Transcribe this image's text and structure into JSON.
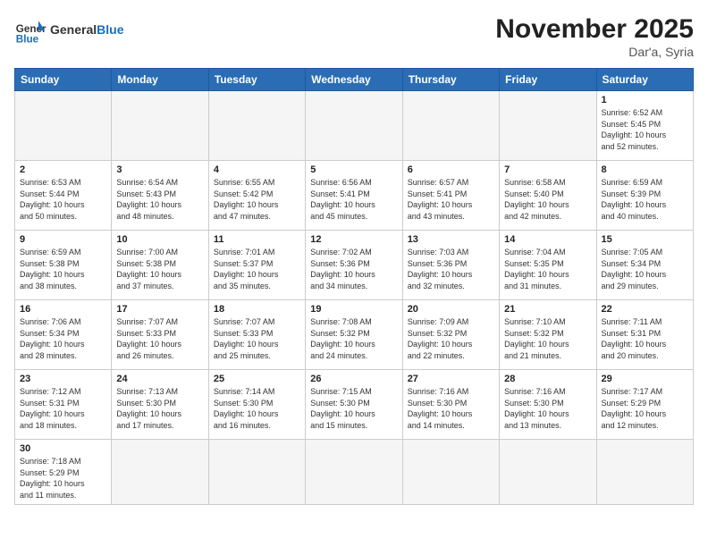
{
  "header": {
    "logo_general": "General",
    "logo_blue": "Blue",
    "month_title": "November 2025",
    "location": "Dar'a, Syria"
  },
  "weekdays": [
    "Sunday",
    "Monday",
    "Tuesday",
    "Wednesday",
    "Thursday",
    "Friday",
    "Saturday"
  ],
  "weeks": [
    [
      {
        "day": "",
        "info": ""
      },
      {
        "day": "",
        "info": ""
      },
      {
        "day": "",
        "info": ""
      },
      {
        "day": "",
        "info": ""
      },
      {
        "day": "",
        "info": ""
      },
      {
        "day": "",
        "info": ""
      },
      {
        "day": "1",
        "info": "Sunrise: 6:52 AM\nSunset: 5:45 PM\nDaylight: 10 hours\nand 52 minutes."
      }
    ],
    [
      {
        "day": "2",
        "info": "Sunrise: 6:53 AM\nSunset: 5:44 PM\nDaylight: 10 hours\nand 50 minutes."
      },
      {
        "day": "3",
        "info": "Sunrise: 6:54 AM\nSunset: 5:43 PM\nDaylight: 10 hours\nand 48 minutes."
      },
      {
        "day": "4",
        "info": "Sunrise: 6:55 AM\nSunset: 5:42 PM\nDaylight: 10 hours\nand 47 minutes."
      },
      {
        "day": "5",
        "info": "Sunrise: 6:56 AM\nSunset: 5:41 PM\nDaylight: 10 hours\nand 45 minutes."
      },
      {
        "day": "6",
        "info": "Sunrise: 6:57 AM\nSunset: 5:41 PM\nDaylight: 10 hours\nand 43 minutes."
      },
      {
        "day": "7",
        "info": "Sunrise: 6:58 AM\nSunset: 5:40 PM\nDaylight: 10 hours\nand 42 minutes."
      },
      {
        "day": "8",
        "info": "Sunrise: 6:59 AM\nSunset: 5:39 PM\nDaylight: 10 hours\nand 40 minutes."
      }
    ],
    [
      {
        "day": "9",
        "info": "Sunrise: 6:59 AM\nSunset: 5:38 PM\nDaylight: 10 hours\nand 38 minutes."
      },
      {
        "day": "10",
        "info": "Sunrise: 7:00 AM\nSunset: 5:38 PM\nDaylight: 10 hours\nand 37 minutes."
      },
      {
        "day": "11",
        "info": "Sunrise: 7:01 AM\nSunset: 5:37 PM\nDaylight: 10 hours\nand 35 minutes."
      },
      {
        "day": "12",
        "info": "Sunrise: 7:02 AM\nSunset: 5:36 PM\nDaylight: 10 hours\nand 34 minutes."
      },
      {
        "day": "13",
        "info": "Sunrise: 7:03 AM\nSunset: 5:36 PM\nDaylight: 10 hours\nand 32 minutes."
      },
      {
        "day": "14",
        "info": "Sunrise: 7:04 AM\nSunset: 5:35 PM\nDaylight: 10 hours\nand 31 minutes."
      },
      {
        "day": "15",
        "info": "Sunrise: 7:05 AM\nSunset: 5:34 PM\nDaylight: 10 hours\nand 29 minutes."
      }
    ],
    [
      {
        "day": "16",
        "info": "Sunrise: 7:06 AM\nSunset: 5:34 PM\nDaylight: 10 hours\nand 28 minutes."
      },
      {
        "day": "17",
        "info": "Sunrise: 7:07 AM\nSunset: 5:33 PM\nDaylight: 10 hours\nand 26 minutes."
      },
      {
        "day": "18",
        "info": "Sunrise: 7:07 AM\nSunset: 5:33 PM\nDaylight: 10 hours\nand 25 minutes."
      },
      {
        "day": "19",
        "info": "Sunrise: 7:08 AM\nSunset: 5:32 PM\nDaylight: 10 hours\nand 24 minutes."
      },
      {
        "day": "20",
        "info": "Sunrise: 7:09 AM\nSunset: 5:32 PM\nDaylight: 10 hours\nand 22 minutes."
      },
      {
        "day": "21",
        "info": "Sunrise: 7:10 AM\nSunset: 5:32 PM\nDaylight: 10 hours\nand 21 minutes."
      },
      {
        "day": "22",
        "info": "Sunrise: 7:11 AM\nSunset: 5:31 PM\nDaylight: 10 hours\nand 20 minutes."
      }
    ],
    [
      {
        "day": "23",
        "info": "Sunrise: 7:12 AM\nSunset: 5:31 PM\nDaylight: 10 hours\nand 18 minutes."
      },
      {
        "day": "24",
        "info": "Sunrise: 7:13 AM\nSunset: 5:30 PM\nDaylight: 10 hours\nand 17 minutes."
      },
      {
        "day": "25",
        "info": "Sunrise: 7:14 AM\nSunset: 5:30 PM\nDaylight: 10 hours\nand 16 minutes."
      },
      {
        "day": "26",
        "info": "Sunrise: 7:15 AM\nSunset: 5:30 PM\nDaylight: 10 hours\nand 15 minutes."
      },
      {
        "day": "27",
        "info": "Sunrise: 7:16 AM\nSunset: 5:30 PM\nDaylight: 10 hours\nand 14 minutes."
      },
      {
        "day": "28",
        "info": "Sunrise: 7:16 AM\nSunset: 5:30 PM\nDaylight: 10 hours\nand 13 minutes."
      },
      {
        "day": "29",
        "info": "Sunrise: 7:17 AM\nSunset: 5:29 PM\nDaylight: 10 hours\nand 12 minutes."
      }
    ],
    [
      {
        "day": "30",
        "info": "Sunrise: 7:18 AM\nSunset: 5:29 PM\nDaylight: 10 hours\nand 11 minutes."
      },
      {
        "day": "",
        "info": ""
      },
      {
        "day": "",
        "info": ""
      },
      {
        "day": "",
        "info": ""
      },
      {
        "day": "",
        "info": ""
      },
      {
        "day": "",
        "info": ""
      },
      {
        "day": "",
        "info": ""
      }
    ]
  ]
}
